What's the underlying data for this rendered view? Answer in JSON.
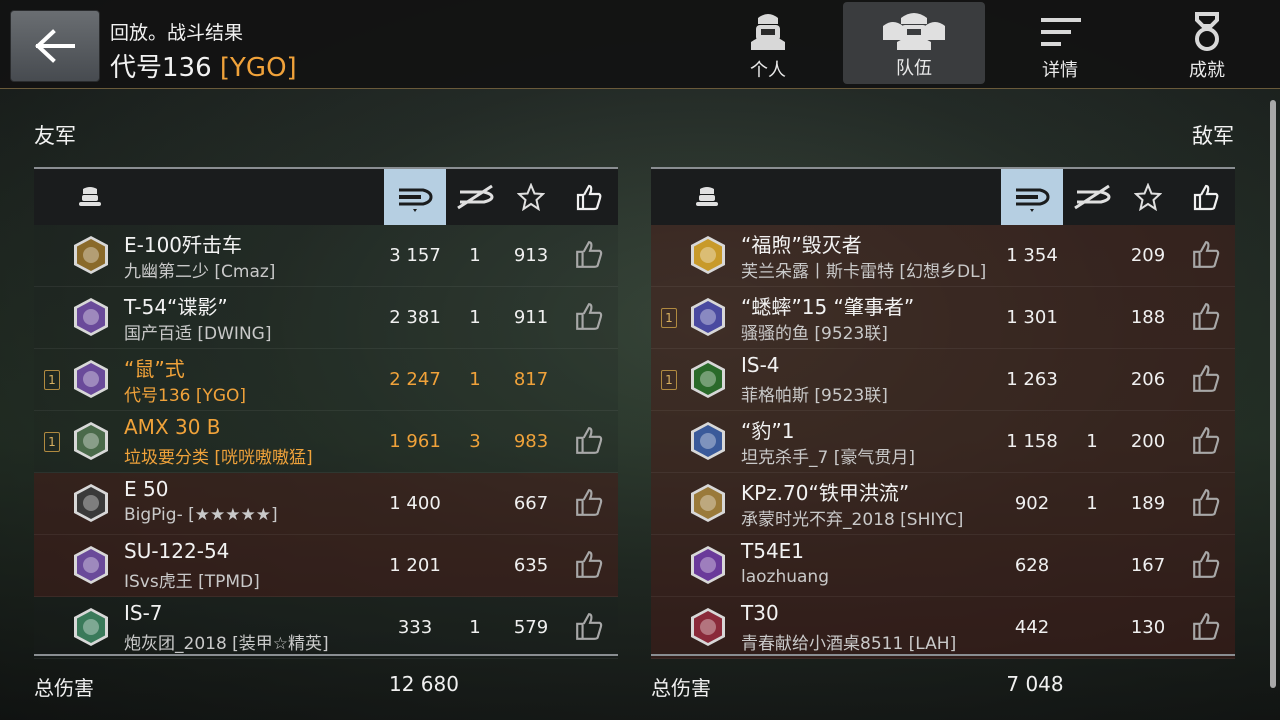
{
  "header": {
    "title": "回放。战斗结果",
    "player": "代号136",
    "clan": "[YGO]"
  },
  "tabs": [
    {
      "label": "个人",
      "icon": "player-icon"
    },
    {
      "label": "队伍",
      "icon": "team-icon"
    },
    {
      "label": "详情",
      "icon": "details-icon"
    },
    {
      "label": "成就",
      "icon": "medal-icon"
    }
  ],
  "allies_label": "友军",
  "enemies_label": "敌军",
  "total_damage_label": "总伤害",
  "allies_total": "12 680",
  "enemies_total": "7 048",
  "allies": [
    {
      "tank": "E-100歼击车",
      "player": "九幽第二少 [Cmaz]",
      "damage": "3 157",
      "kills": "1",
      "score": "913",
      "status": "alive",
      "rank": "",
      "mine": false,
      "like": true
    },
    {
      "tank": "T-54“谍影”",
      "player": "国产百适 [DWING]",
      "damage": "2 381",
      "kills": "1",
      "score": "911",
      "status": "alive",
      "rank": "",
      "mine": false,
      "like": true
    },
    {
      "tank": "“鼠”式",
      "player": "代号136 [YGO]",
      "damage": "2 247",
      "kills": "1",
      "score": "817",
      "status": "alive",
      "rank": "1",
      "mine": true,
      "like": false
    },
    {
      "tank": "AMX 30 B",
      "player": "垃圾要分类 [咣咣嗷嗷猛]",
      "damage": "1 961",
      "kills": "3",
      "score": "983",
      "status": "alive",
      "rank": "1",
      "mine": true,
      "like": true
    },
    {
      "tank": "E 50",
      "player": "BigPig- [★★★★★]",
      "damage": "1 400",
      "kills": "",
      "score": "667",
      "status": "dead",
      "rank": "",
      "mine": false,
      "like": true
    },
    {
      "tank": "SU-122-54",
      "player": "ISvs虎王 [TPMD]",
      "damage": "1 201",
      "kills": "",
      "score": "635",
      "status": "dead",
      "rank": "",
      "mine": false,
      "like": true
    },
    {
      "tank": "IS-7",
      "player": "炮灰团_2018 [装甲☆精英]",
      "damage": "333",
      "kills": "1",
      "score": "579",
      "status": "alive",
      "rank": "",
      "mine": false,
      "like": true
    }
  ],
  "enemies": [
    {
      "tank": "“福煦”毁灭者",
      "player": "芙兰朵露丨斯卡雷特 [幻想乡DL]",
      "damage": "1 354",
      "kills": "",
      "score": "209",
      "status": "dead",
      "rank": "",
      "mine": false,
      "like": true
    },
    {
      "tank": "“蟋蟀”15 “肇事者”",
      "player": "骚骚的鱼 [9523联]",
      "damage": "1 301",
      "kills": "",
      "score": "188",
      "status": "dead",
      "rank": "1",
      "mine": false,
      "like": true
    },
    {
      "tank": "IS-4",
      "player": "菲格帕斯 [9523联]",
      "damage": "1 263",
      "kills": "",
      "score": "206",
      "status": "dead",
      "rank": "1",
      "mine": false,
      "like": true
    },
    {
      "tank": "“豹”1",
      "player": "坦克杀手_7 [豪气贯月]",
      "damage": "1 158",
      "kills": "1",
      "score": "200",
      "status": "dead",
      "rank": "",
      "mine": false,
      "like": true
    },
    {
      "tank": "KPz.70“铁甲洪流”",
      "player": "承蒙时光不弃_2018 [SHIYC]",
      "damage": "902",
      "kills": "1",
      "score": "189",
      "status": "dead",
      "rank": "",
      "mine": false,
      "like": true
    },
    {
      "tank": "T54E1",
      "player": "laozhuang",
      "damage": "628",
      "kills": "",
      "score": "167",
      "status": "dead",
      "rank": "",
      "mine": false,
      "like": true
    },
    {
      "tank": "T30",
      "player": "青春献给小酒桌8511 [LAH]",
      "damage": "442",
      "kills": "",
      "score": "130",
      "status": "dead",
      "rank": "",
      "mine": false,
      "like": true
    }
  ],
  "colors": {
    "accent": "#f0a23a",
    "dead_row": "#46201a",
    "active_header": "#b6cfe2"
  }
}
